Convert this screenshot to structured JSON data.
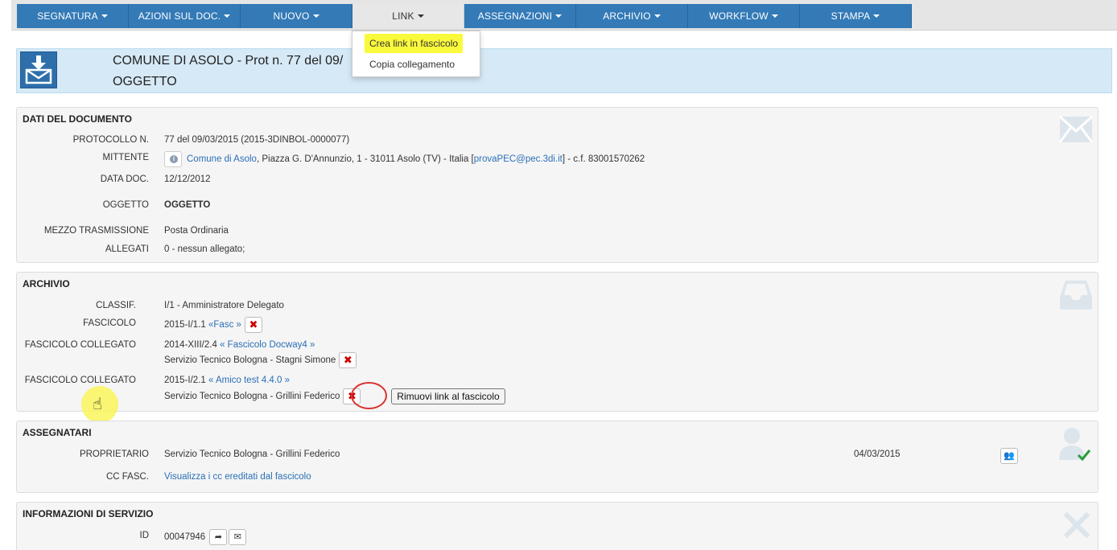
{
  "nav": {
    "items": [
      {
        "label": "SEGNATURA"
      },
      {
        "label": "AZIONI SUL DOC."
      },
      {
        "label": "NUOVO"
      },
      {
        "label": "LINK"
      },
      {
        "label": "ASSEGNAZIONI"
      },
      {
        "label": "ARCHIVIO"
      },
      {
        "label": "WORKFLOW"
      },
      {
        "label": "STAMPA"
      }
    ],
    "dropdown": {
      "item1": "Crea link in fascicolo",
      "item2": "Copia collegamento"
    }
  },
  "header": {
    "title": "COMUNE DI ASOLO - Prot n. 77 del 09/",
    "subtitle": "OGGETTO"
  },
  "dati": {
    "title": "DATI DEL DOCUMENTO",
    "protocollo_label": "PROTOCOLLO N.",
    "protocollo_value": "77 del 09/03/2015 (2015-3DINBOL-0000077)",
    "mittente_label": "MITTENTE",
    "mittente_link": "Comune di Asolo",
    "mittente_addr": ", Piazza G. D'Annunzio, 1 - 31011 Asolo (TV) - Italia [",
    "mittente_pec": "provaPEC@pec.3di.it",
    "mittente_tail": "] - c.f. 83001570262",
    "data_label": "DATA DOC.",
    "data_value": "12/12/2012",
    "oggetto_label": "OGGETTO",
    "oggetto_value": "OGGETTO",
    "mezzo_label": "MEZZO TRASMISSIONE",
    "mezzo_value": "Posta Ordinaria",
    "allegati_label": "ALLEGATI",
    "allegati_value": "0 - nessun allegato;"
  },
  "archivio": {
    "title": "ARCHIVIO",
    "classif_label": "CLASSIF.",
    "classif_value": "I/1 - Amministratore Delegato",
    "fascicolo_label": "FASCICOLO",
    "fascicolo_code": "2015-I/1.1",
    "fascicolo_link": "«Fasc »",
    "coll1_label": "FASCICOLO COLLEGATO",
    "coll1_code": "2014-XIII/2.4",
    "coll1_link_open": "«",
    "coll1_link": "Fascicolo Docway4",
    "coll1_link_close": "»",
    "coll1_owner": "Servizio Tecnico Bologna - Stagni Simone",
    "coll2_label": "FASCICOLO COLLEGATO",
    "coll2_code": "2015-I/2.1",
    "coll2_link_open": "«",
    "coll2_link": "Amico test 4.4.0",
    "coll2_link_close": "»",
    "coll2_owner": "Servizio Tecnico Bologna - Grillini Federico",
    "tooltip": "Rimuovi link al fascicolo"
  },
  "assegnatari": {
    "title": "ASSEGNATARI",
    "proprietario_label": "PROPRIETARIO",
    "proprietario_value": "Servizio Tecnico Bologna - Grillini Federico",
    "proprietario_date": "04/03/2015",
    "cc_label": "CC FASC.",
    "cc_link": "Visualizza i cc ereditati dal fascicolo"
  },
  "servizio": {
    "title": "INFORMAZIONI DI SERVIZIO",
    "id_label": "ID",
    "id_value": "00047946"
  }
}
